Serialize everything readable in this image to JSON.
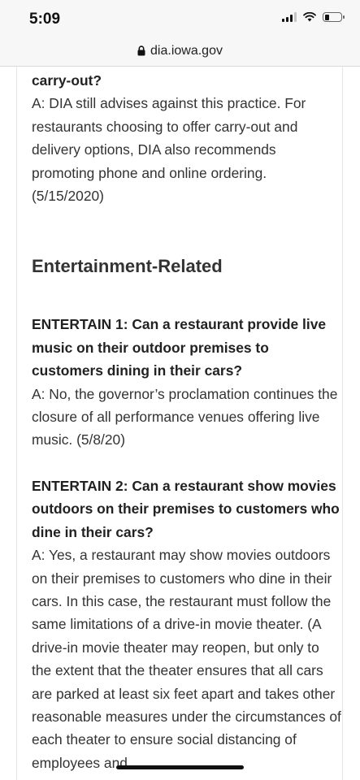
{
  "status_bar": {
    "time": "5:09",
    "battery_level": 0.25
  },
  "browser": {
    "url": "dia.iowa.gov"
  },
  "article": {
    "prev_question_tail": "carry-out?",
    "prev_answer": "A: DIA still advises against this practice. For restaurants choosing to offer carry-out and delivery options, DIA also recommends promoting phone and online ordering. (5/15/2020)",
    "section_heading": "Entertainment-Related",
    "qa": [
      {
        "question": "ENTERTAIN 1: Can a restaurant provide live music on their outdoor premises to customers dining in their cars?",
        "answer": "A: No, the governor’s proclamation continues the closure of all performance venues offering live music. (5/8/20)"
      },
      {
        "question": "ENTERTAIN 2: Can a restaurant show movies outdoors on their premises to customers who dine in their cars?",
        "answer": "A: Yes, a restaurant may show movies outdoors on their premises to customers who dine in their cars. In this case, the restaurant must follow the same limitations of a drive-in movie theater. (A drive-in movie theater may reopen, but only to the extent that the theater ensures that all cars are parked at least six feet apart and takes other reasonable measures under the circumstances of each theater to ensure social distancing of employees and"
      }
    ]
  }
}
